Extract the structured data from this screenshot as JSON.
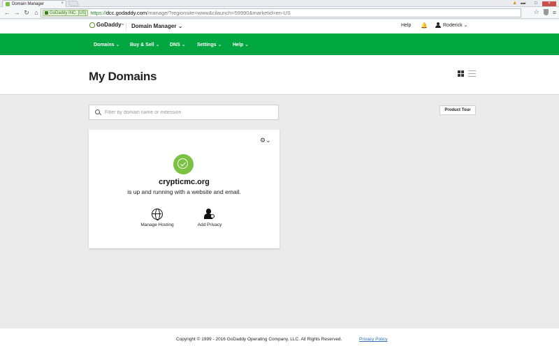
{
  "browser": {
    "tab_title": "Domain Manager",
    "ev_label": "GoDaddy INC. [US]",
    "url_scheme": "https://",
    "url_host": "dcc.godaddy.com",
    "url_path": "/manage/?regionsite=www&cilaunch=59990&marketid=en-US"
  },
  "header": {
    "logo_text": "GoDaddy",
    "product": "Domain Manager",
    "help": "Help",
    "user": "Roderick"
  },
  "nav": {
    "items": [
      {
        "label": "Domains"
      },
      {
        "label": "Buy & Sell"
      },
      {
        "label": "DNS"
      },
      {
        "label": "Settings"
      },
      {
        "label": "Help"
      }
    ]
  },
  "page": {
    "title": "My Domains",
    "search_placeholder": "Filter by domain name or extension",
    "product_tour": "Product Tour"
  },
  "card": {
    "domain": "crypticmc.org",
    "status_text": "is up and running with a website and email.",
    "actions": [
      {
        "label": "Manage Hosting",
        "icon": "globe-icon"
      },
      {
        "label": "Add Privacy",
        "icon": "privacy-icon"
      }
    ],
    "status_color": "#7cc242"
  },
  "footer": {
    "copyright": "Copyright ©  1999 - 2016 GoDaddy Operating Company, LLC. All Rights Reserved.",
    "privacy": "Privacy Policy"
  },
  "colors": {
    "brand_green": "#00a63f",
    "link_blue": "#2a6ebb"
  }
}
